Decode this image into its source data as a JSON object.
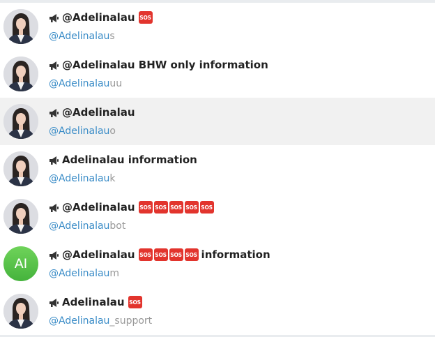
{
  "results": [
    {
      "title": "@Adelinalau",
      "sos_count": 1,
      "title_suffix": "",
      "handle_match": "@Adelinalau",
      "handle_rest": "s",
      "avatar": "photo"
    },
    {
      "title": "@Adelinalau BHW only information",
      "sos_count": 0,
      "title_suffix": "",
      "handle_match": "@Adelinalau",
      "handle_rest": "uu",
      "avatar": "photo"
    },
    {
      "title": "@Adelinalau",
      "sos_count": 0,
      "title_suffix": "",
      "handle_match": "@Adelinalau",
      "handle_rest": "o",
      "avatar": "photo",
      "highlighted": true
    },
    {
      "title": "Adelinalau information",
      "sos_count": 0,
      "title_suffix": "",
      "handle_match": "@Adelinalau",
      "handle_rest": "k",
      "avatar": "photo"
    },
    {
      "title": "@Adelinalau",
      "sos_count": 5,
      "title_suffix": "",
      "handle_match": "@Adelinalau",
      "handle_rest": "bot",
      "avatar": "photo"
    },
    {
      "title": "@Adelinalau",
      "sos_count": 4,
      "title_suffix": "information",
      "handle_match": "@Adelinalau",
      "handle_rest": "m",
      "avatar": "initials",
      "initials": "AI"
    },
    {
      "title": "Adelinalau",
      "sos_count": 1,
      "title_suffix": "",
      "handle_match": "@Adelinalau",
      "handle_rest": "_support",
      "avatar": "photo"
    }
  ],
  "sos_label": "SOS",
  "icons": {
    "channel": "megaphone-icon",
    "badge": "sos-icon"
  },
  "colors": {
    "match": "#3a8cc7",
    "rest": "#999999",
    "sos": "#e2342d",
    "highlight": "#f1f1f1"
  }
}
